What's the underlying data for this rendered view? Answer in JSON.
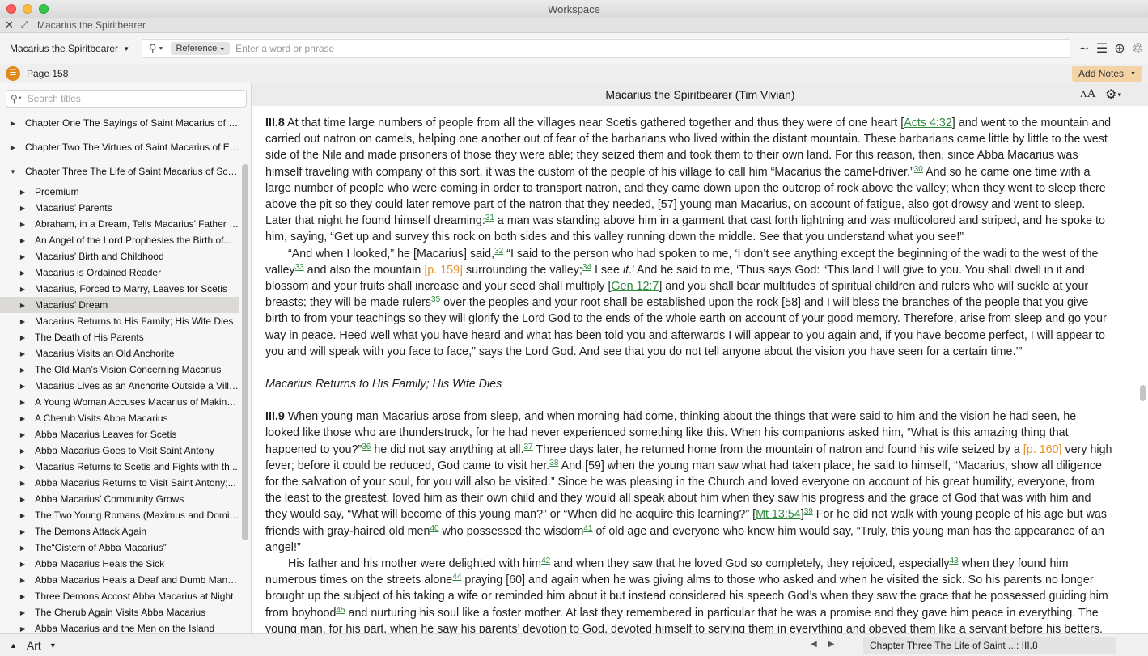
{
  "window": {
    "title": "Workspace"
  },
  "panel": {
    "title": "Macarius the Spiritbearer"
  },
  "toolbar": {
    "book_picker": "Macarius the Spiritbearer",
    "search_type": "Reference",
    "search_placeholder": "Enter a word or phrase"
  },
  "pagebar": {
    "page_label": "Page 158",
    "add_notes": "Add Notes"
  },
  "sidebar": {
    "search_placeholder": "Search titles",
    "items": [
      {
        "label": "Chapter One The Sayings of Saint Macarius of E...",
        "level": 1,
        "expanded": false
      },
      {
        "label": "Chapter Two The Virtues of Saint Macarius of Eg...",
        "level": 1,
        "expanded": false
      },
      {
        "label": "Chapter Three The Life of Saint Macarius of Scetis",
        "level": 1,
        "expanded": true
      },
      {
        "label": "Proemium",
        "level": 2
      },
      {
        "label": "Macarius’ Parents",
        "level": 2
      },
      {
        "label": "Abraham, in a Dream, Tells Macarius’ Father to...",
        "level": 2
      },
      {
        "label": "An Angel of the Lord Prophesies the Birth of...",
        "level": 2
      },
      {
        "label": "Macarius’ Birth and Childhood",
        "level": 2
      },
      {
        "label": "Macarius is Ordained Reader",
        "level": 2
      },
      {
        "label": "Macarius, Forced to Marry, Leaves for Scetis",
        "level": 2
      },
      {
        "label": "Macarius’ Dream",
        "level": 2,
        "selected": true
      },
      {
        "label": "Macarius Returns to His Family; His Wife Dies",
        "level": 2
      },
      {
        "label": "The Death of His Parents",
        "level": 2
      },
      {
        "label": "Macarius Visits an Old Anchorite",
        "level": 2
      },
      {
        "label": "The Old Man’s Vision Concerning Macarius",
        "level": 2
      },
      {
        "label": "Macarius Lives as an Anchorite Outside a Villa...",
        "level": 2
      },
      {
        "label": "A Young Woman Accuses Macarius of Making...",
        "level": 2
      },
      {
        "label": "A Cherub Visits Abba Macarius",
        "level": 2
      },
      {
        "label": "Abba Macarius Leaves for Scetis",
        "level": 2
      },
      {
        "label": "Abba Macarius Goes to Visit Saint Antony",
        "level": 2
      },
      {
        "label": "Macarius Returns to Scetis and Fights with th...",
        "level": 2
      },
      {
        "label": "Abba Macarius Returns to Visit Saint Antony;...",
        "level": 2
      },
      {
        "label": "Abba Macarius’ Community Grows",
        "level": 2
      },
      {
        "label": "The Two Young Romans (Maximus and Domiti...",
        "level": 2
      },
      {
        "label": "The Demons Attack Again",
        "level": 2
      },
      {
        "label": "The“Cistern of Abba Macarius”",
        "level": 2
      },
      {
        "label": "Abba Macarius Heals the Sick",
        "level": 2
      },
      {
        "label": "Abba Macarius Heals a Deaf and Dumb Man P...",
        "level": 2
      },
      {
        "label": "Three Demons Accost Abba Macarius at Night",
        "level": 2
      },
      {
        "label": "The Cherub Again Visits Abba Macarius",
        "level": 2
      },
      {
        "label": "Abba Macarius and the Men on the Island",
        "level": 2
      }
    ]
  },
  "content": {
    "header": "Macarius the Spiritbearer (Tim Vivian)",
    "font_size_icon": "AA",
    "section_heading": "Macarius Returns to His Family; His Wife Dies"
  },
  "footer": {
    "layout_picker": "Art",
    "location": "Chapter Three The Life of Saint ...: III.8"
  },
  "colors": {
    "accent_orange": "#e08a1e",
    "link_green": "#2f8a3e",
    "page_ref_orange": "#e8942c",
    "add_notes_bg": "#f3d3a6"
  }
}
